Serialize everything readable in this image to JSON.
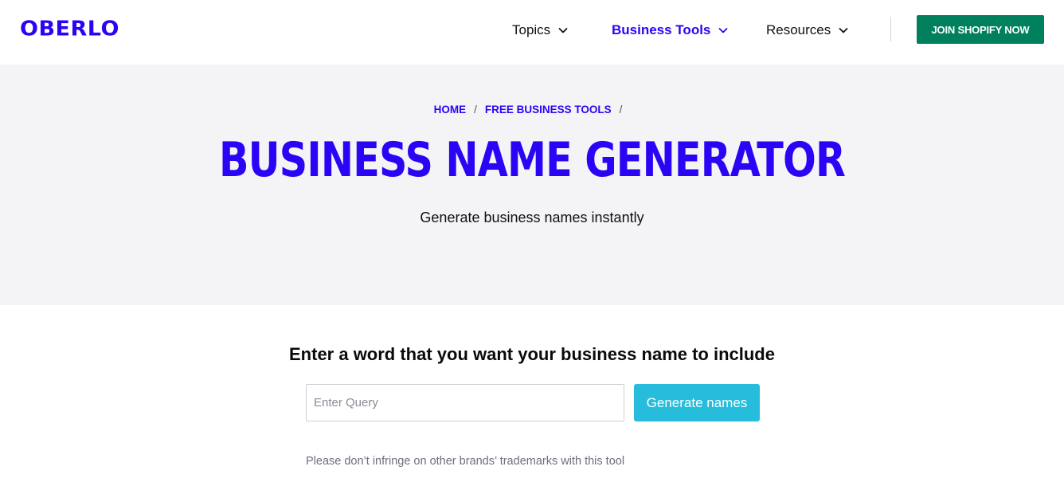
{
  "header": {
    "logo": "OBERLO",
    "nav": [
      {
        "label": "Topics"
      },
      {
        "label": "Business Tools"
      },
      {
        "label": "Resources"
      }
    ],
    "cta_label": "JOIN SHOPIFY NOW"
  },
  "hero": {
    "breadcrumb": [
      "HOME",
      "FREE BUSINESS TOOLS"
    ],
    "title": "BUSINESS NAME GENERATOR",
    "subtitle": "Generate business names instantly"
  },
  "tool": {
    "prompt": "Enter a word that you want your business name to include",
    "query_value": "",
    "query_placeholder": "Enter Query",
    "button_label": "Generate names",
    "notice": "Please don’t infringe on other brands’ trademarks with this tool"
  },
  "colors": {
    "brand": "#2a05f5",
    "cta": "#00805d",
    "hero_bg": "#f4f4f6",
    "generate_button": "#26bcdc"
  },
  "icons": {
    "nav_dropdown": "chevron-down-icon"
  }
}
